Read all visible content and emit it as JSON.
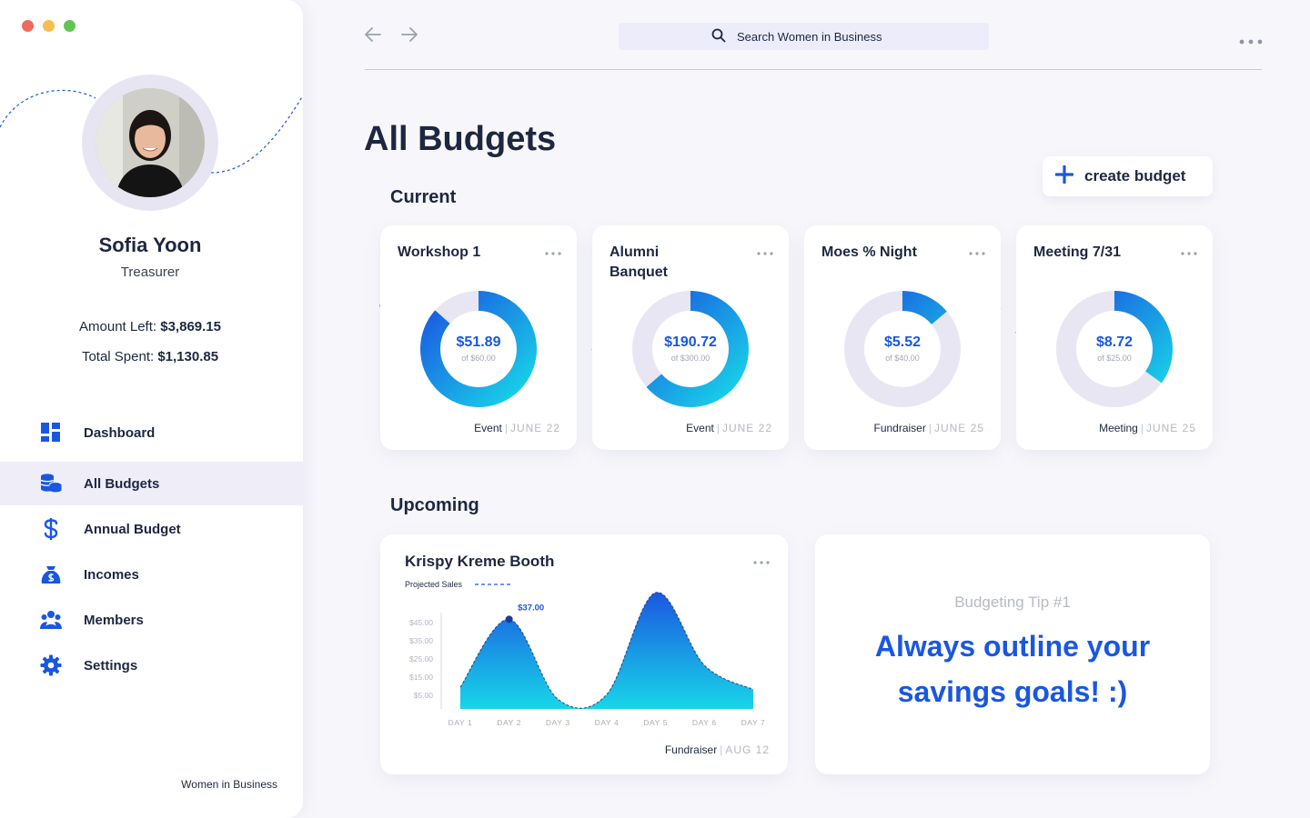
{
  "window": {
    "traffic_lights": [
      "#ee6a5f",
      "#f5be4f",
      "#61c554"
    ]
  },
  "topbar": {
    "search_placeholder": "Search Women in Business"
  },
  "profile": {
    "name": "Sofia Yoon",
    "role": "Treasurer",
    "amount_left_label": "Amount Left:",
    "amount_left_value": "$3,869.15",
    "total_spent_label": "Total Spent:",
    "total_spent_value": "$1,130.85"
  },
  "nav": [
    {
      "label": "Dashboard",
      "icon": "dashboard-icon",
      "active": false
    },
    {
      "label": "All Budgets",
      "icon": "coins-icon",
      "active": true
    },
    {
      "label": "Annual Budget",
      "icon": "dollar-icon",
      "active": false
    },
    {
      "label": "Incomes",
      "icon": "money-bag-icon",
      "active": false
    },
    {
      "label": "Members",
      "icon": "members-icon",
      "active": false
    },
    {
      "label": "Settings",
      "icon": "gear-icon",
      "active": false
    }
  ],
  "footer_brand": "Women in Business",
  "page": {
    "title": "All Budgets",
    "current_label": "Current",
    "upcoming_label": "Upcoming",
    "create_label": "create budget"
  },
  "budgets": [
    {
      "title": "Workshop 1",
      "amount": "$51.89",
      "of": "of $60.00",
      "type": "Event",
      "date": "JUNE 22",
      "fraction": 0.865
    },
    {
      "title": "Alumni Banquet",
      "amount": "$190.72",
      "of": "of $300.00",
      "type": "Event",
      "date": "JUNE 22",
      "fraction": 0.636
    },
    {
      "title": "Moes % Night",
      "amount": "$5.52",
      "of": "of $40.00",
      "type": "Fundraiser",
      "date": "JUNE 25",
      "fraction": 0.138
    },
    {
      "title": "Meeting 7/31",
      "amount": "$8.72",
      "of": "of $25.00",
      "type": "Meeting",
      "date": "JUNE 25",
      "fraction": 0.349
    }
  ],
  "upcoming": {
    "title": "Krispy Kreme Booth",
    "legend": "Projected Sales",
    "type": "Fundraiser",
    "date": "AUG 12"
  },
  "tip": {
    "label": "Budgeting Tip #1",
    "text": "Always outline your savings goals! :)"
  },
  "colors": {
    "accent": "#1a57e0",
    "accent_light": "#18d6e8",
    "track": "#e7e6f2",
    "text": "#1d2740"
  },
  "chart_data": {
    "type": "area",
    "title": "Krispy Kreme Booth",
    "categories": [
      "DAY 1",
      "DAY 2",
      "DAY 3",
      "DAY 4",
      "DAY 5",
      "DAY 6",
      "DAY 7"
    ],
    "y_ticks": [
      "$45.00",
      "$35.00",
      "$25.00",
      "$15.00",
      "$5.00"
    ],
    "ylim": [
      0,
      48
    ],
    "series": [
      {
        "name": "Projected Sales",
        "values": [
          9,
          37,
          4,
          6,
          48,
          18,
          8
        ]
      }
    ],
    "annotation": {
      "label": "$37.00",
      "category": "DAY 2",
      "value": 37
    }
  }
}
